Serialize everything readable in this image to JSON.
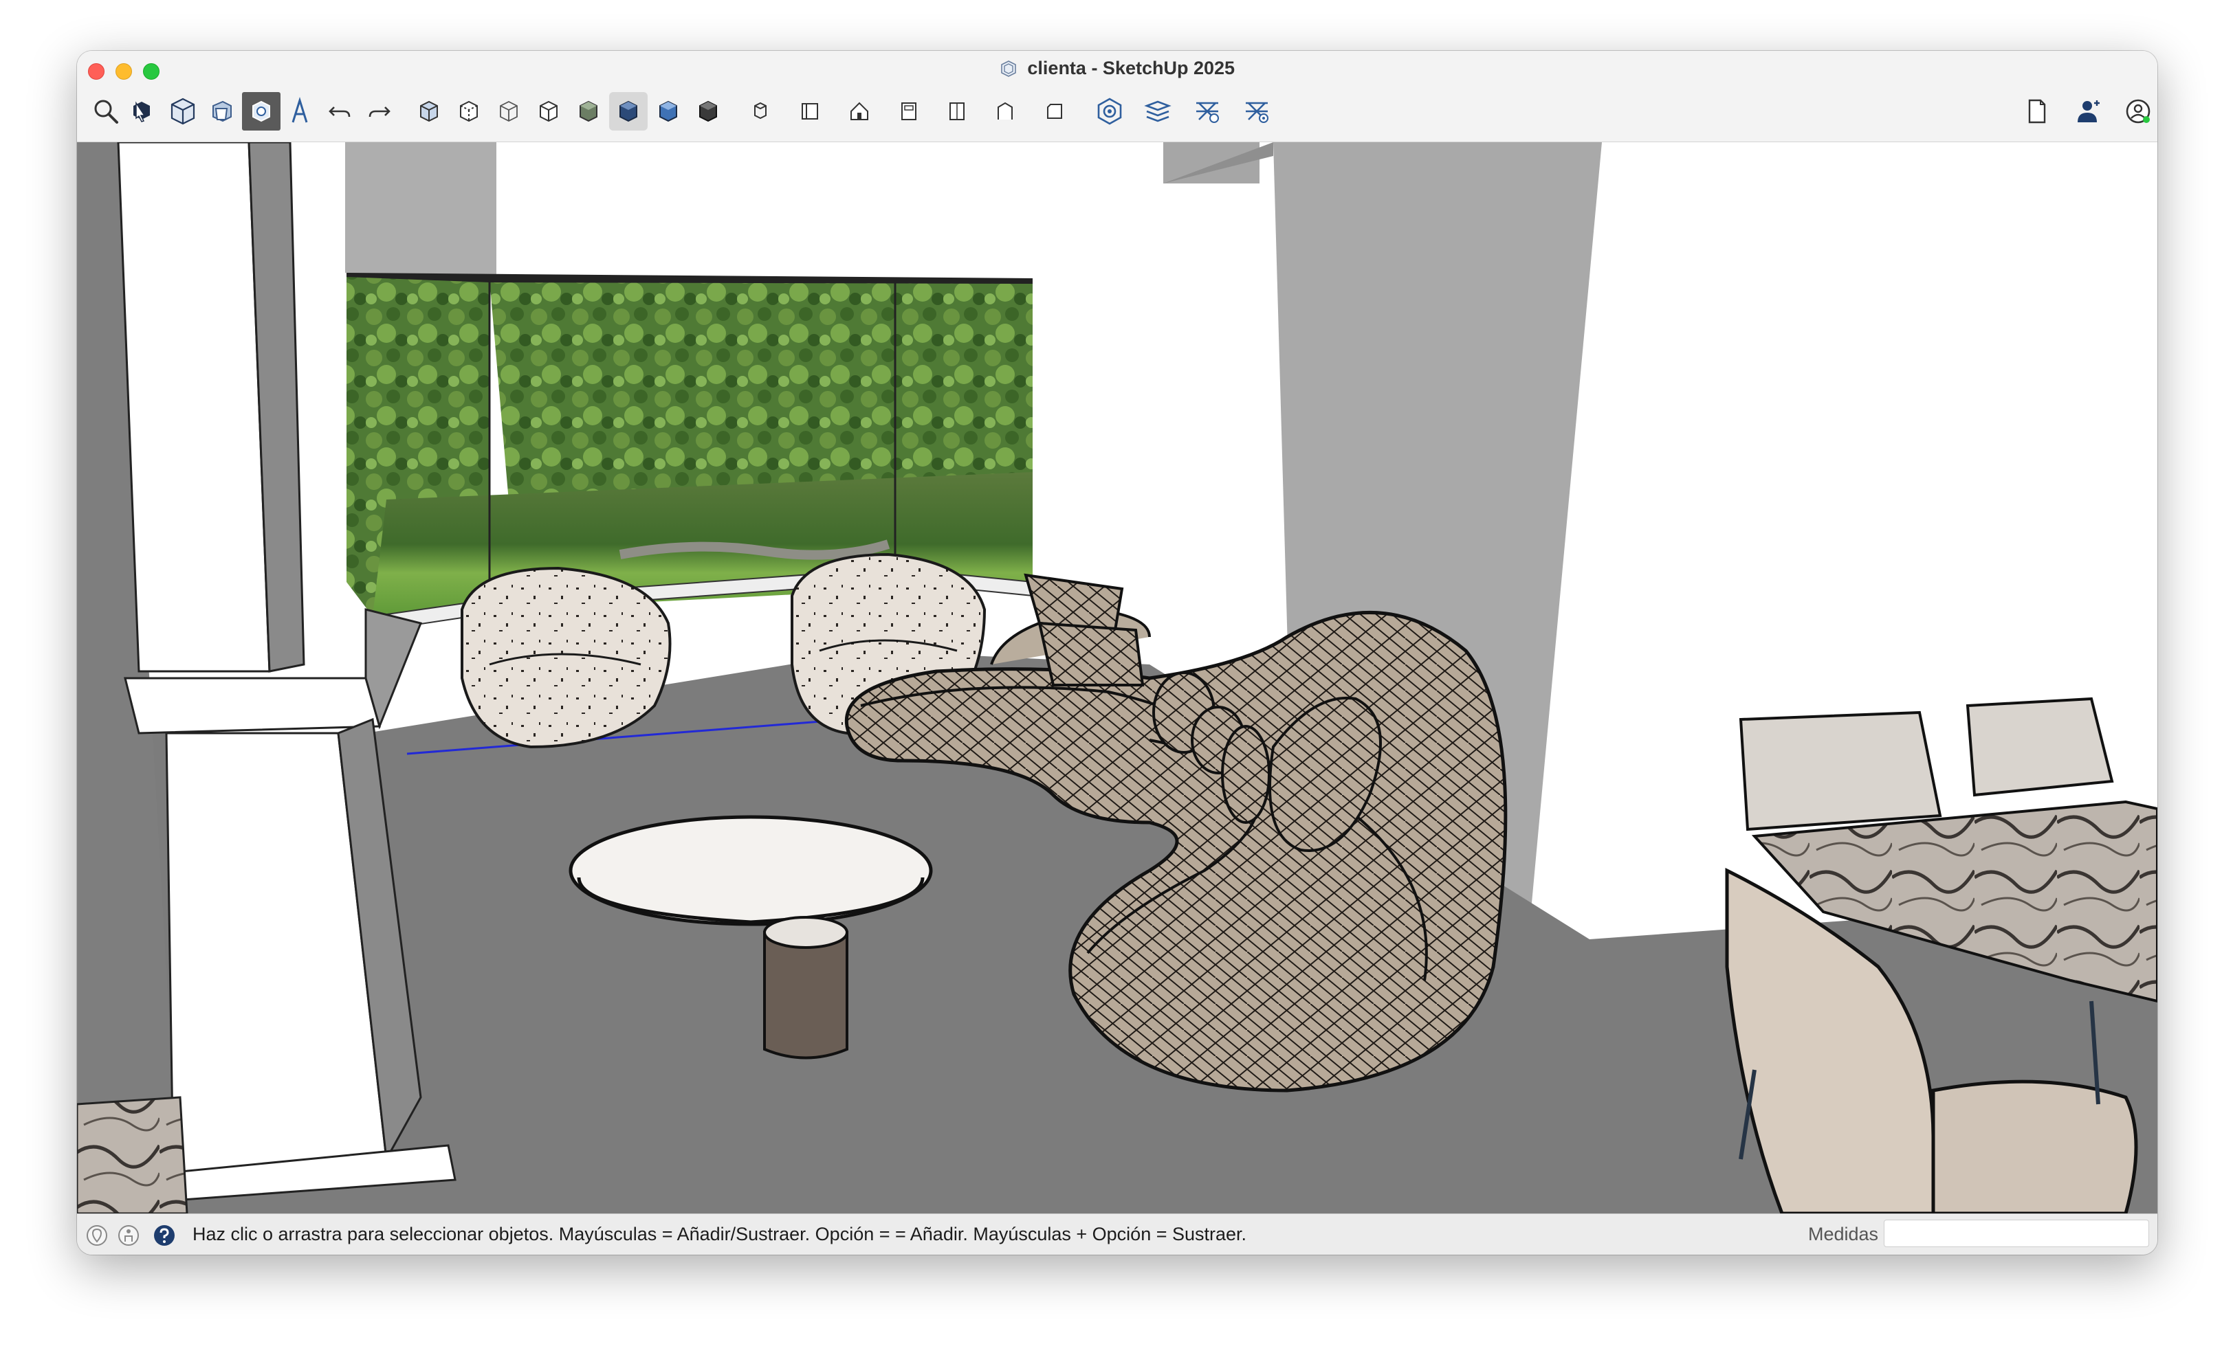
{
  "window": {
    "title": "clienta - SketchUp 2025",
    "title_icon": "sketchup-logo-icon"
  },
  "toolbar": {
    "left_tools": [
      {
        "name": "search-icon"
      },
      {
        "name": "select-tool-icon"
      },
      {
        "name": "make-component-icon"
      },
      {
        "name": "paint-bucket-icon"
      },
      {
        "name": "eraser-tool-icon",
        "state": "active"
      },
      {
        "name": "text-tool-icon"
      },
      {
        "name": "undo-icon"
      },
      {
        "name": "redo-icon"
      },
      {
        "name": "xray-style-icon"
      },
      {
        "name": "back-edges-style-icon"
      },
      {
        "name": "wireframe-style-icon"
      },
      {
        "name": "hidden-line-style-icon"
      },
      {
        "name": "shaded-style-icon"
      },
      {
        "name": "shaded-textures-style-icon",
        "state": "pressed"
      },
      {
        "name": "monochrome-style-icon"
      },
      {
        "name": "dark-shaded-style-icon"
      },
      {
        "name": "iso-view-icon"
      },
      {
        "name": "top-view-icon"
      },
      {
        "name": "front-view-icon"
      },
      {
        "name": "right-view-icon"
      },
      {
        "name": "back-view-icon"
      },
      {
        "name": "left-view-icon"
      },
      {
        "name": "bottom-view-icon"
      },
      {
        "name": "3d-warehouse-icon"
      },
      {
        "name": "extension-warehouse-icon"
      },
      {
        "name": "send-to-layout-icon"
      },
      {
        "name": "extension-manager-icon"
      }
    ],
    "right_tools": [
      {
        "name": "model-info-icon"
      },
      {
        "name": "user-account-icon"
      },
      {
        "name": "profile-icon"
      }
    ]
  },
  "statusbar": {
    "geolocation_icon": "geolocation-icon",
    "credits_icon": "credits-icon",
    "help_icon": "help-icon",
    "message": "Haz clic o arrastra para seleccionar objetos. Mayúsculas = Añadir/Sustraer. Opción = = Añadir. Mayúsculas + Opción = Sustraer.",
    "measurements_label": "Medidas",
    "measurements_value": ""
  },
  "colors": {
    "titlebar_bg": "#f3f3f3",
    "active_tool_bg": "#5a5a5a",
    "help_badge": "#1e3d6e",
    "icon_blue": "#2f5f9e",
    "floor": "#7c7c7c",
    "wall_gray": "#a9a9a9"
  }
}
